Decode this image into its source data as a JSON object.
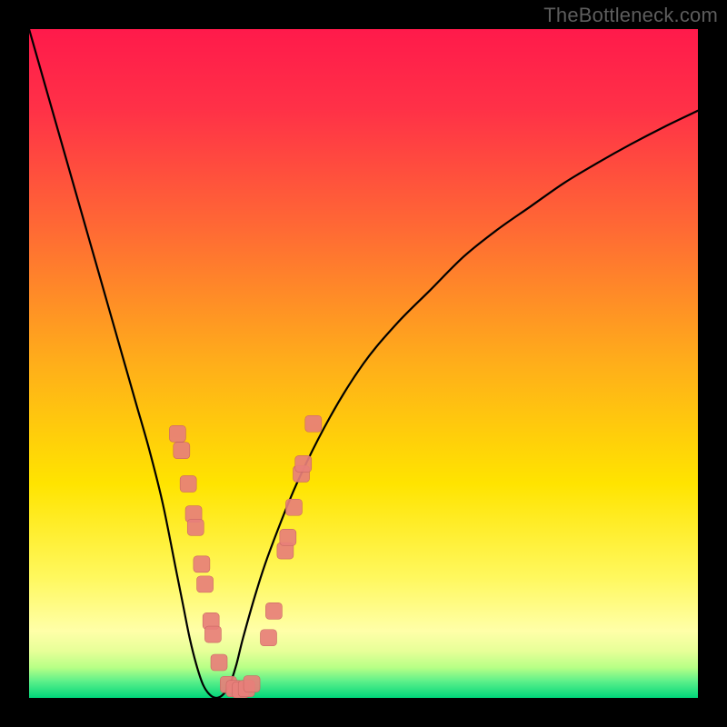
{
  "attribution": "TheBottleneck.com",
  "colors": {
    "frame": "#000000",
    "gradient_top": "#ff1a4b",
    "gradient_mid1": "#ff7a2a",
    "gradient_mid2": "#ffe g00",
    "gradient_bottom_band_top": "#cfff6a",
    "gradient_bottom_band_bottom": "#00d67a",
    "curve": "#000000",
    "marker_fill": "#e77f7a",
    "marker_stroke": "#b85a55"
  },
  "chart_data": {
    "type": "line",
    "title": "",
    "xlabel": "",
    "ylabel": "",
    "xlim": [
      0,
      100
    ],
    "ylim": [
      0,
      100
    ],
    "grid": false,
    "series": [
      {
        "name": "bottleneck-curve",
        "x": [
          0,
          2,
          4,
          6,
          8,
          10,
          12,
          14,
          16,
          18,
          20,
          22,
          23,
          24,
          25,
          26,
          27,
          28,
          29,
          30,
          31,
          32,
          34,
          36,
          40,
          45,
          50,
          55,
          60,
          65,
          70,
          75,
          80,
          85,
          90,
          95,
          100
        ],
        "y": [
          100,
          93,
          86,
          79,
          72,
          65,
          58,
          51,
          44,
          37,
          29,
          19,
          14,
          9,
          5,
          2,
          0.5,
          0,
          0.5,
          2,
          5,
          9,
          16,
          22,
          32,
          42,
          50,
          56,
          61,
          66,
          70,
          73.5,
          77,
          80,
          82.8,
          85.4,
          87.8
        ]
      }
    ],
    "markers": {
      "shape": "rounded-square",
      "size": 18,
      "points": [
        {
          "x": 22.2,
          "y": 39.5
        },
        {
          "x": 22.8,
          "y": 37.0
        },
        {
          "x": 23.8,
          "y": 32.0
        },
        {
          "x": 24.6,
          "y": 27.5
        },
        {
          "x": 24.9,
          "y": 25.5
        },
        {
          "x": 25.8,
          "y": 20.0
        },
        {
          "x": 26.3,
          "y": 17.0
        },
        {
          "x": 27.2,
          "y": 11.5
        },
        {
          "x": 27.5,
          "y": 9.5
        },
        {
          "x": 28.4,
          "y": 5.3
        },
        {
          "x": 29.8,
          "y": 2.0
        },
        {
          "x": 30.7,
          "y": 1.4
        },
        {
          "x": 31.6,
          "y": 1.2
        },
        {
          "x": 32.5,
          "y": 1.4
        },
        {
          "x": 33.3,
          "y": 2.1
        },
        {
          "x": 35.8,
          "y": 9.0
        },
        {
          "x": 36.6,
          "y": 13.0
        },
        {
          "x": 38.3,
          "y": 22.0
        },
        {
          "x": 38.7,
          "y": 24.0
        },
        {
          "x": 39.6,
          "y": 28.5
        },
        {
          "x": 40.7,
          "y": 33.5
        },
        {
          "x": 41.0,
          "y": 35.0
        },
        {
          "x": 42.5,
          "y": 41.0
        }
      ]
    }
  }
}
